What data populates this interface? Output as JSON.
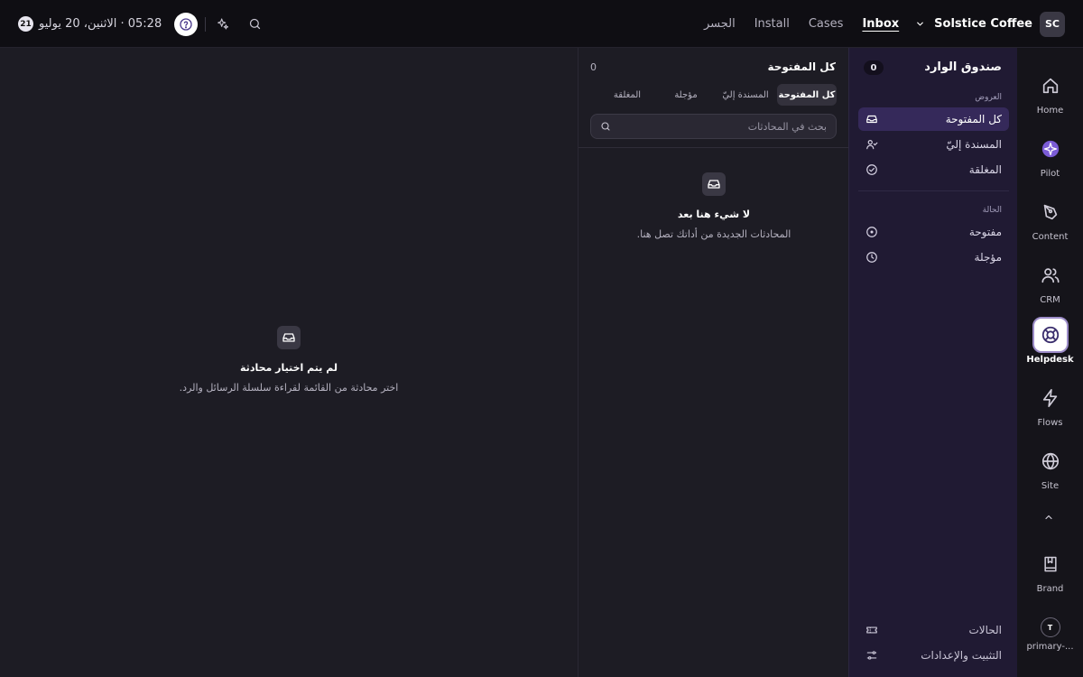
{
  "topbar": {
    "date_badge": "21",
    "date_text": "05:28 · الاثنين، 20 يوليو",
    "nav": [
      "الجسر",
      "Install",
      "Cases",
      "Inbox"
    ],
    "active_nav": "Inbox",
    "workspace_name": "Solstice Coffee",
    "avatar_initials": "SC"
  },
  "rail": {
    "items": [
      {
        "label": "Home",
        "icon": "home-icon"
      },
      {
        "label": "Pilot",
        "icon": "pilot-icon"
      },
      {
        "label": "Content",
        "icon": "pen-icon"
      },
      {
        "label": "CRM",
        "icon": "users-icon"
      },
      {
        "label": "Helpdesk",
        "icon": "lifebuoy-icon",
        "active": true
      },
      {
        "label": "Flows",
        "icon": "bolt-icon"
      },
      {
        "label": "Site",
        "icon": "globe-icon"
      },
      {
        "label": "Brand",
        "icon": "book-icon"
      }
    ],
    "workspace_initial": "T",
    "workspace_label": "primary-..."
  },
  "sidebar": {
    "title": "صندوق الوارد",
    "count": "0",
    "views_heading": "العروض",
    "views": [
      {
        "label": "كل المفتوحة",
        "icon": "inbox-icon",
        "active": true
      },
      {
        "label": "المسندة إليّ",
        "icon": "user-check-icon"
      },
      {
        "label": "المغلقة",
        "icon": "check-circle-icon"
      }
    ],
    "status_heading": "الحالة",
    "statuses": [
      {
        "label": "مفتوحة",
        "icon": "circle-dot-icon"
      },
      {
        "label": "مؤجلة",
        "icon": "clock-icon"
      }
    ],
    "bottom": [
      {
        "label": "الحالات",
        "icon": "ticket-icon"
      },
      {
        "label": "التثبيت والإعدادات",
        "icon": "sliders-icon"
      }
    ]
  },
  "list": {
    "title": "كل المفتوحة",
    "count": "0",
    "tabs": [
      "كل المفتوحة",
      "المسندة إليّ",
      "مؤجلة",
      "المغلقة"
    ],
    "active_tab": "كل المفتوحة",
    "search_placeholder": "بحث في المحادثات",
    "empty_title": "لا شيء هنا بعد",
    "empty_desc": "المحادثات الجديدة من أداتك تصل هنا."
  },
  "detail": {
    "empty_title": "لم يتم اختيار محادثة",
    "empty_desc": "اختر محادثة من القائمة لقراءة سلسلة الرسائل والرد."
  },
  "colors": {
    "topbar_bg": "#0f0e13",
    "sidebar_bg": "#201a33",
    "active_view_bg": "#35295a",
    "pilot_accent": "#7b5cd6",
    "main_bg": "#1d1c24"
  }
}
